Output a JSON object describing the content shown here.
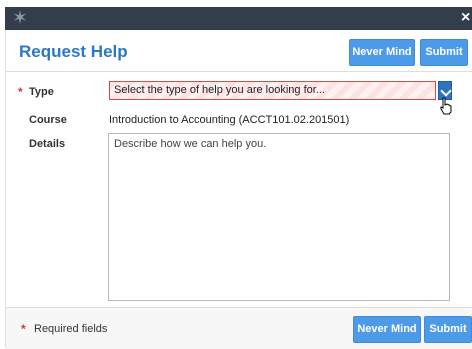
{
  "window": {
    "logo_icon": "star-logo-icon",
    "close_icon": "close-icon",
    "close_glyph": "×"
  },
  "dialog": {
    "title": "Request Help",
    "buttons": {
      "never_mind": "Never Mind",
      "submit": "Submit"
    },
    "form": {
      "type": {
        "label": "Type",
        "required_marker": "*",
        "selected_value": "Select the type of help you are looking for..."
      },
      "course": {
        "label": "Course",
        "value": "Introduction to Accounting (ACCT101.02.201501)"
      },
      "details": {
        "label": "Details",
        "placeholder": "Describe how we can help you."
      }
    },
    "footer": {
      "required_marker": "*",
      "required_text": "Required fields"
    }
  },
  "colors": {
    "title_blue": "#2d78c6",
    "button_blue": "#4d9be8",
    "required_red": "#d53535",
    "titlebar": "#333d4c"
  }
}
